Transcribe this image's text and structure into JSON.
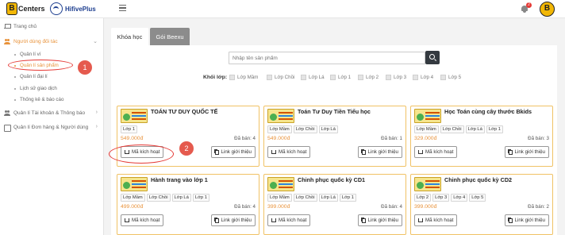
{
  "header": {
    "brand_centers_text": "Centers",
    "brand_centers_mark": "B",
    "brand_hifive_text": "HifivePlus",
    "notification_count": "2",
    "avatar_letter": "B"
  },
  "sidebar": {
    "items": [
      {
        "label": "Trang chủ"
      },
      {
        "label": "Người dùng đối tác"
      },
      {
        "label": "Quản lí Tài khoản & Thông báo"
      },
      {
        "label": "Quản lí Đơn hàng & Người dùng"
      }
    ],
    "subitems": [
      {
        "label": "Quản lí ví"
      },
      {
        "label": "Quản lí sản phẩm"
      },
      {
        "label": "Quản lí đại lí"
      },
      {
        "label": "Lịch sử giao dịch"
      },
      {
        "label": "Thống kê & báo cáo"
      }
    ]
  },
  "annotations": {
    "marker_1": "1",
    "marker_2": "2"
  },
  "tabs": [
    {
      "label": "Khóa học",
      "active": true
    },
    {
      "label": "Gói Beexu",
      "active": false
    }
  ],
  "search": {
    "placeholder": "Nhập tên sản phẩm"
  },
  "filter": {
    "label": "Khối lớp:",
    "options": [
      "Lớp Mầm",
      "Lớp Chồi",
      "Lớp Lá",
      "Lớp 1",
      "Lớp 2",
      "Lớp 3",
      "Lớp 4",
      "Lớp 5"
    ]
  },
  "products": [
    {
      "title": "TOÁN TƯ DUY QUỐC TẾ",
      "tags": [
        "Lớp 1"
      ],
      "price": "549.000đ",
      "sold": "Đã bán: 4",
      "code_btn": "Mã kích hoạt",
      "intro_btn": "Link giới thiệu"
    },
    {
      "title": "Toán Tư Duy Tiền Tiểu học",
      "tags": [
        "Lớp Mầm",
        "Lớp Chồi",
        "Lớp Lá"
      ],
      "price": "549.000đ",
      "sold": "Đã bán: 1",
      "code_btn": "Mã kích hoạt",
      "intro_btn": "Link giới thiệu"
    },
    {
      "title": "Học Toán cùng cây thước Bkids",
      "tags": [
        "Lớp Mầm",
        "Lớp Chồi",
        "Lớp Lá",
        "Lớp 1"
      ],
      "price": "329.000đ",
      "sold": "Đã bán: 3",
      "code_btn": "Mã kích hoạt",
      "intro_btn": "Link giới thiệu"
    },
    {
      "title": "Hành trang vào lớp 1",
      "tags": [
        "Lớp Mầm",
        "Lớp Chồi",
        "Lớp Lá",
        "Lớp 1"
      ],
      "price": "499.000đ",
      "sold": "Đã bán: 4",
      "code_btn": "Mã kích hoạt",
      "intro_btn": "Link giới thiệu"
    },
    {
      "title": "Chinh phục quốc kỳ CD1",
      "tags": [
        "Lớp Mầm",
        "Lớp Chồi",
        "Lớp Lá",
        "Lớp 1"
      ],
      "price": "399.000đ",
      "sold": "Đã bán: 4",
      "code_btn": "Mã kích hoạt",
      "intro_btn": "Link giới thiệu"
    },
    {
      "title": "Chinh phục quốc kỳ CD2",
      "tags": [
        "Lớp 2",
        "Lớp 3",
        "Lớp 4",
        "Lớp 5"
      ],
      "price": "399.000đ",
      "sold": "Đã bán: 2",
      "code_btn": "Mã kích hoạt",
      "intro_btn": "Link giới thiệu"
    }
  ],
  "colors": {
    "accent": "#e8923a",
    "annotation": "#e53935",
    "card_border": "#f0c265"
  }
}
